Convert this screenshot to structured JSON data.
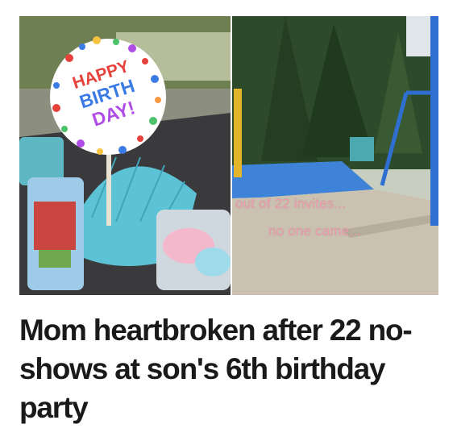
{
  "article": {
    "headline": "Mom heartbroken after 22 no-shows at son's 6th birthday party",
    "image": {
      "sign_text": [
        "HAPPY",
        "BIRTH",
        "DAY!"
      ],
      "caption_line1": "out of 22 invites...",
      "caption_line2": "no one came..."
    }
  },
  "colors": {
    "headline": "#1a1a1a",
    "caption": "#f2a1b4",
    "teal": "#5cc3d6",
    "playground_blue": "#2f6fd1"
  }
}
